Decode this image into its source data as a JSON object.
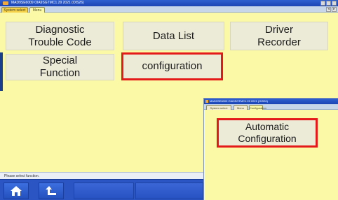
{
  "window": {
    "title": "MAD9SE6009 OIA9SGTMC1.29 2021 (OIS26)",
    "tabs": [
      {
        "label": "System select",
        "active": true
      },
      {
        "label": "Menu",
        "active": false
      }
    ]
  },
  "menu": {
    "buttons": [
      {
        "label": "Diagnostic\nTrouble Code",
        "highlighted": false
      },
      {
        "label": "Data List",
        "highlighted": false
      },
      {
        "label": "Driver\nRecorder",
        "highlighted": false
      },
      {
        "label": "Special\nFunction",
        "highlighted": false
      },
      {
        "label": "configuration",
        "highlighted": true
      }
    ]
  },
  "status": {
    "text": "Please select function."
  },
  "toolbar": {
    "buttons": [
      {
        "icon": "home-icon"
      },
      {
        "icon": "back-arrow-icon"
      }
    ]
  },
  "subwindow": {
    "title": "MAD9SE6009 OIA9SGTMC1.29 2021 (OIS26)",
    "tabs": [
      {
        "label": "System select"
      },
      {
        "label": "Menu"
      },
      {
        "label": "Configuration"
      }
    ],
    "button": {
      "label": "Automatic\nConfiguration",
      "highlighted": true
    }
  },
  "colors": {
    "content_bg": "#fbf9a6",
    "highlight": "#e41a1a",
    "toolbar": "#2a55c3",
    "titlebar": "#1c45b3"
  }
}
